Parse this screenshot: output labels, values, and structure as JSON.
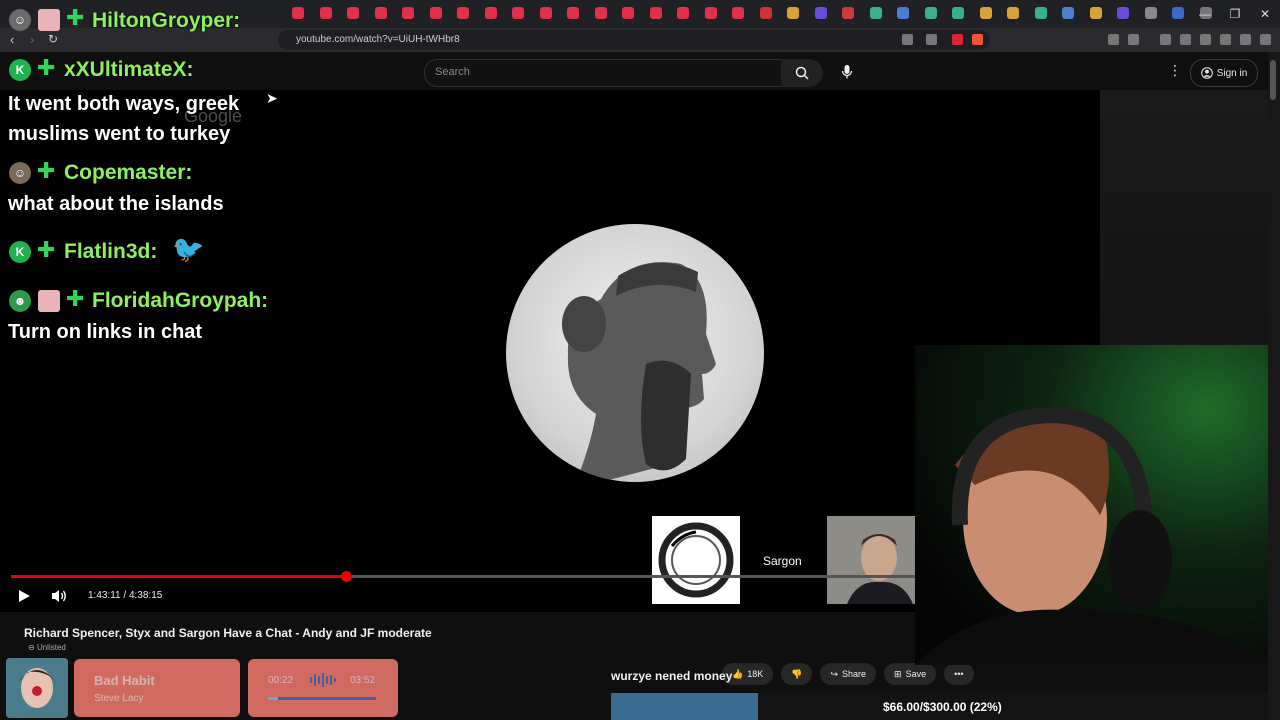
{
  "browser": {
    "url": "youtube.com/watch?v=UiUH-tWHbr8",
    "window_controls": [
      "—",
      "❐",
      "✕"
    ]
  },
  "youtube": {
    "search_placeholder": "Search",
    "signin_label": "Sign in",
    "video_title": "Richard Spencer, Styx and Sargon Have a Chat - Andy and JF moderate",
    "visibility": "Unlisted",
    "time_current": "1:43:11",
    "time_total": "4:38:15",
    "time_display": "1:43:11 / 4:38:15",
    "progress_fraction": 0.371,
    "participant_label": "Sargon",
    "like_count": "18K",
    "share_label": "Share",
    "save_label": "Save"
  },
  "chat": [
    {
      "user": "HiltonGroyper:",
      "message": ""
    },
    {
      "user": "xXUltimateX:",
      "message": "It went both ways, greek muslims went to turkey"
    },
    {
      "user": "Copemaster:",
      "message": "what about the islands"
    },
    {
      "user": "Flatlin3d:",
      "message": ""
    },
    {
      "user": "FloridahGroypah:",
      "message": "Turn on links in chat"
    }
  ],
  "music": {
    "title": "Bad Habit",
    "artist": "Steve Lacy",
    "current": "00:22",
    "duration": "03:52",
    "progress_fraction": 0.095
  },
  "overlay": {
    "channel_text": "wurzye nened money",
    "goal_text": "$66.00/$300.00 (22%)",
    "goal_fraction": 0.22,
    "watermark": "Google"
  },
  "colors": {
    "chat_username": "#8ef05f",
    "progress_red": "#ee0000",
    "goal_blue": "#3a6c92",
    "music_widget": "#f27b6f"
  }
}
